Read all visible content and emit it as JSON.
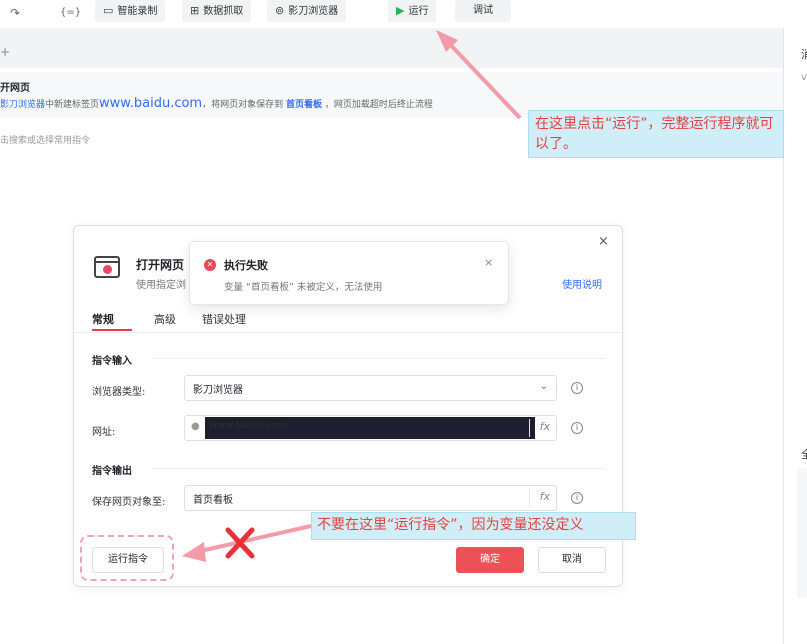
{
  "toolbar": {
    "redo_icon": "↷",
    "variables_icon": "{=}",
    "smart_record": "智能录制",
    "data_capture": "数据抓取",
    "browser": "影刀浏览器",
    "run": "运行",
    "debug": "调试"
  },
  "editor": {
    "plus": "+",
    "step_title": "开网页",
    "step_desc_prefix": "影刀浏览器",
    "step_desc_mid": "中新建标签页",
    "step_desc_url": "www.baidu.com",
    "step_desc_save": "，将网页对象保存到",
    "step_desc_var": "首页看板",
    "step_desc_suffix": "，网页加载超时后终止流程",
    "search_hint": "击搜索或选择常用指令"
  },
  "right_panel": {
    "char1": "消",
    "char2": "v",
    "char3": "全"
  },
  "annotations": {
    "top_callout": "在这里点击“运行”，完整运行程序就可以了。",
    "bottom_callout": "不要在这里“运行指令”，因为变量还没定义",
    "arrow_color": "#f39ba8",
    "callout_text_color": "#e8403f",
    "callout_bg": "#cfeef8"
  },
  "dialog": {
    "close": "×",
    "title": "打开网页",
    "subtitle": "使用指定浏",
    "help": "使用说明",
    "tabs": [
      "常规",
      "高级",
      "错误处理"
    ],
    "section_input": "指令输入",
    "browser_type_label": "浏览器类型:",
    "browser_type_value": "影刀浏览器",
    "url_label": "网址:",
    "url_value": "www.baidu.com",
    "section_output": "指令输出",
    "save_label": "保存网页对象至:",
    "save_value": "首页看板",
    "fx": "fx",
    "run_cmd": "运行指令",
    "ok": "确定",
    "cancel": "取消"
  },
  "toast": {
    "title": "执行失败",
    "message": "变量 “首页看板” 未被定义，无法使用",
    "close": "×"
  },
  "colors": {
    "accent_red": "#ee5058",
    "link_blue": "#2f6bff",
    "run_green": "#27b14f"
  }
}
